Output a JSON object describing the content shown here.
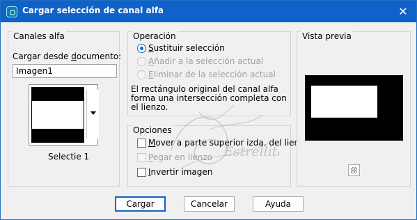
{
  "window": {
    "title": "Cargar selección de canal alfa",
    "close_glyph": "✕"
  },
  "canales": {
    "legend": "Canales alfa",
    "load_from_label_before": "Cargar desde ",
    "load_from_label_underlined": "d",
    "load_from_label_after": "ocumento:",
    "document_value": "Imagen1",
    "channel_name": "Selectie 1"
  },
  "operacion": {
    "legend": "Operación",
    "options": [
      {
        "before": "",
        "underlined": "S",
        "after": "ustituir selección",
        "checked": true,
        "disabled": false
      },
      {
        "before": "",
        "underlined": "A",
        "after": "ñadir a la selección actual",
        "checked": false,
        "disabled": true
      },
      {
        "before": "",
        "underlined": "E",
        "after": "liminar de la selección actual",
        "checked": false,
        "disabled": true
      }
    ],
    "info_line1": "El rectángulo original del canal alfa",
    "info_line2": "forma una intersección completa con",
    "info_line3": "el lienzo."
  },
  "opciones": {
    "legend": "Opciones",
    "items": [
      {
        "before": "",
        "underlined": "M",
        "after": "over a parte superior izda. del lienzo",
        "checked": false,
        "disabled": false
      },
      {
        "before": "",
        "underlined": "P",
        "after": "egar en lienzo",
        "checked": false,
        "disabled": true
      },
      {
        "before": "",
        "underlined": "I",
        "after": "nvertir imagen",
        "checked": false,
        "disabled": false
      }
    ]
  },
  "vista": {
    "legend": "Vista previa"
  },
  "watermark": {
    "text": "Estrellita"
  },
  "buttons": {
    "load": "Cargar",
    "cancel": "Cancelar",
    "help": "Ayuda"
  }
}
